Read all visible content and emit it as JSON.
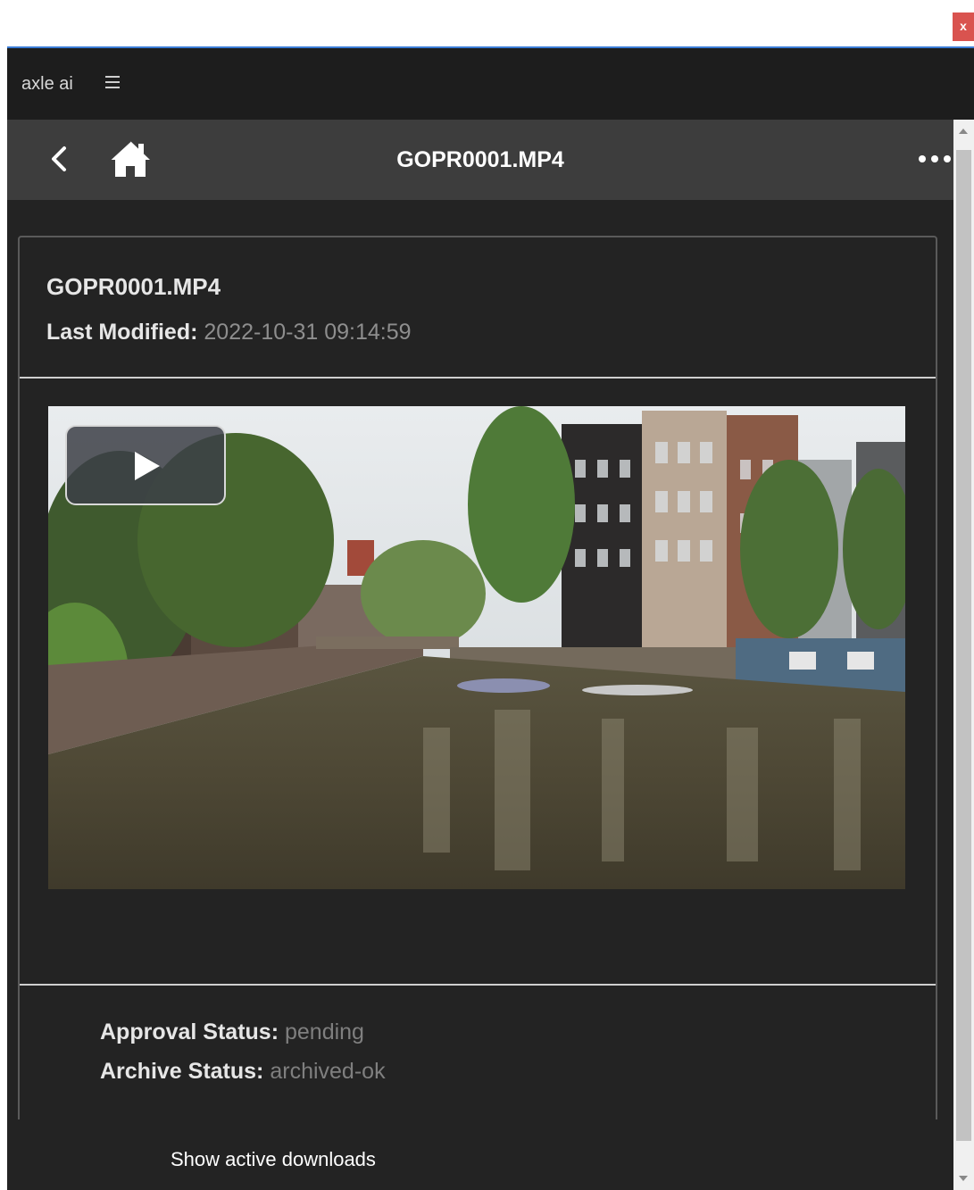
{
  "window": {
    "close_label": "x"
  },
  "appbar": {
    "title": "axle ai",
    "menu_icon": "hamburger-icon"
  },
  "navbar": {
    "title": "GOPR0001.MP4",
    "back_icon": "chevron-left-icon",
    "home_icon": "home-icon",
    "more_icon": "more-horizontal-icon"
  },
  "asset": {
    "name": "GOPR0001.MP4",
    "last_modified_label": "Last Modified:",
    "last_modified_value": "2022-10-31 09:14:59",
    "approval_label": "Approval Status:",
    "approval_value": "pending",
    "archive_label": "Archive Status:",
    "archive_value": "archived-ok"
  },
  "player": {
    "play_icon": "play-icon"
  },
  "footer": {
    "downloads_label": "Show active downloads"
  },
  "colors": {
    "accent": "#3a7bd5",
    "close": "#d9534f",
    "appbar_bg": "#1d1d1d",
    "navbar_bg": "#3d3d3d",
    "content_bg": "#232323"
  }
}
